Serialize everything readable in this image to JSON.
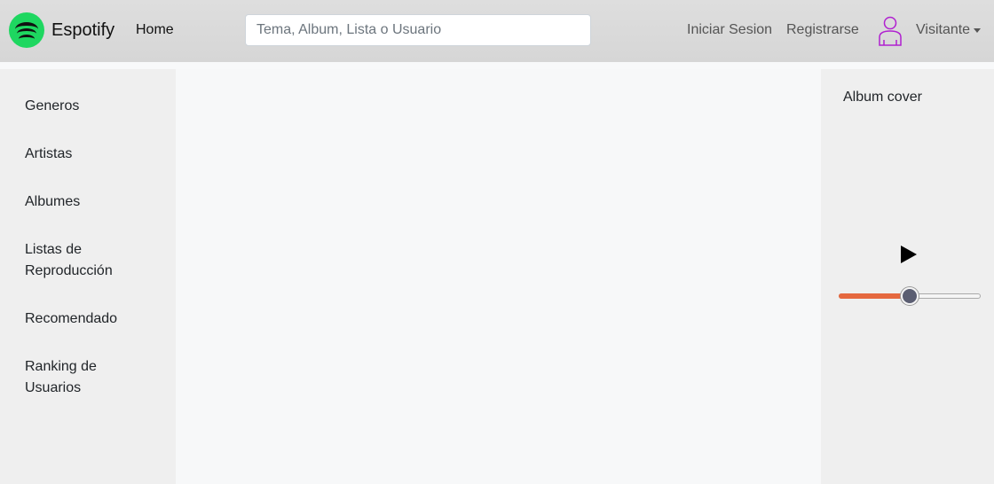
{
  "navbar": {
    "brand": "Espotify",
    "home": "Home",
    "search_placeholder": "Tema, Album, Lista o Usuario",
    "login": "Iniciar Sesion",
    "register": "Registrarse",
    "user": "Visitante"
  },
  "sidebar": {
    "items": [
      {
        "label": "Generos"
      },
      {
        "label": "Artistas"
      },
      {
        "label": "Albumes"
      },
      {
        "label": "Listas de Reproducción"
      },
      {
        "label": "Recomendado"
      },
      {
        "label": "Ranking de Usuarios"
      }
    ]
  },
  "player": {
    "cover_label": "Album cover",
    "volume_percent": 50
  },
  "colors": {
    "brand_green": "#1ed760",
    "user_icon": "#b020d0",
    "slider_fill": "#e5683f"
  }
}
